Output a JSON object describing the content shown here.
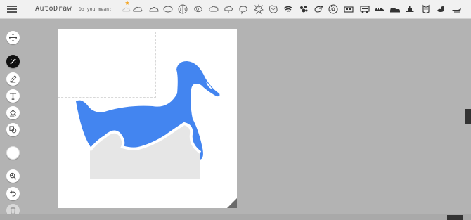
{
  "app": {
    "title": "AutoDraw"
  },
  "suggestions": {
    "label": "Do you mean:",
    "items": [
      "cloud-sparkle-icon",
      "cloud-icon",
      "cloud-outline-icon",
      "ellipse-icon",
      "brain-icon",
      "blob-icon",
      "cloud-wide-icon",
      "leaf-cloud-icon",
      "cloud-bubble-icon",
      "splat-icon",
      "map-icon",
      "wifi-icon",
      "dog-icon",
      "bird-icon",
      "donut-icon",
      "car-icon",
      "truck-icon",
      "train-icon",
      "bus-icon",
      "boat-icon",
      "owl-icon",
      "duck-icon",
      "jet-icon"
    ]
  },
  "tools": [
    {
      "name": "move-icon",
      "label": "Select"
    },
    {
      "name": "autodraw-icon",
      "label": "AutoDraw"
    },
    {
      "name": "pencil-icon",
      "label": "Draw"
    },
    {
      "name": "text-icon",
      "label": "Type"
    },
    {
      "name": "fill-icon",
      "label": "Fill"
    },
    {
      "name": "shape-icon",
      "label": "Shape"
    },
    {
      "name": "color-swatch",
      "label": "Color"
    },
    {
      "name": "zoom-icon",
      "label": "Zoom"
    },
    {
      "name": "undo-icon",
      "label": "Undo"
    },
    {
      "name": "delete-icon",
      "label": "Delete"
    }
  ],
  "colors": {
    "swan": "#4385f0",
    "wave": "#e6e6e6",
    "active_tool": "#111111",
    "color_swatch": "#ffffff"
  }
}
